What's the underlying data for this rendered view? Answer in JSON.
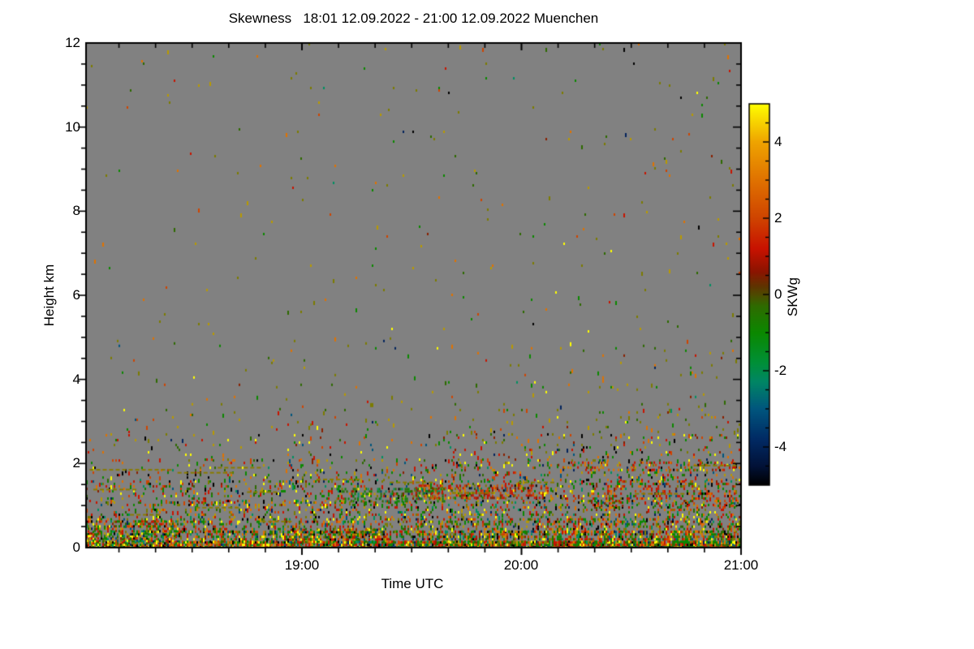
{
  "chart_data": {
    "type": "heatmap",
    "title": "Skewness   18:01 12.09.2022 - 21:00 12.09.2022 Muenchen",
    "xlabel": "Time UTC",
    "ylabel": "Height km",
    "x_start": "18:01",
    "x_end": "21:00",
    "x_total_minutes": 179,
    "x_ticks": [
      {
        "label": "19:00",
        "minutes": 59
      },
      {
        "label": "20:00",
        "minutes": 119
      },
      {
        "label": "21:00",
        "minutes": 179
      }
    ],
    "x_minor_step_minutes": 10,
    "x_first_minor_minute": 9,
    "ylim": [
      0,
      12
    ],
    "y_ticks": [
      {
        "label": "12",
        "km": 12
      },
      {
        "label": "10",
        "km": 10
      },
      {
        "label": "8",
        "km": 8
      },
      {
        "label": "6",
        "km": 6
      },
      {
        "label": "4",
        "km": 4
      },
      {
        "label": "2",
        "km": 2
      },
      {
        "label": "0",
        "km": 0
      }
    ],
    "y_minor_step_km": 0.5,
    "plot_bg": "#818181",
    "frame_color": "#000000",
    "colorbar": {
      "label": "SKWg",
      "range": [
        -5,
        5
      ],
      "ticks": [
        {
          "label": "4",
          "v": 4
        },
        {
          "label": "2",
          "v": 2
        },
        {
          "label": "0",
          "v": 0
        },
        {
          "label": "-2",
          "v": -2
        },
        {
          "label": "-4",
          "v": -4
        }
      ],
      "minor_step": 0.5,
      "stops": [
        [
          5.0,
          "#ffff00"
        ],
        [
          4.0,
          "#efa400"
        ],
        [
          3.0,
          "#e07200"
        ],
        [
          2.0,
          "#cf4400"
        ],
        [
          1.2,
          "#c81200"
        ],
        [
          0.6,
          "#8c1400"
        ],
        [
          0.2,
          "#5e3500"
        ],
        [
          0.0,
          "#4f4a00"
        ],
        [
          -0.3,
          "#2f6b00"
        ],
        [
          -1.0,
          "#0b8800"
        ],
        [
          -1.8,
          "#009038"
        ],
        [
          -2.3,
          "#008565"
        ],
        [
          -3.0,
          "#00567e"
        ],
        [
          -3.8,
          "#012a64"
        ],
        [
          -4.5,
          "#021238"
        ],
        [
          -5.0,
          "#000000"
        ]
      ]
    },
    "noise": {
      "seed": 42,
      "palette": [
        "#c81400",
        "#e07200",
        "#ffff00",
        "#b89a00",
        "#7c7c00",
        "#0b8800",
        "#2d6a00",
        "#009060",
        "#00557e",
        "#02235c",
        "#000000",
        "#8a2000",
        "#cf4400"
      ],
      "weight_sets": {
        "default": [
          14,
          9,
          8,
          6,
          8,
          16,
          10,
          5,
          3,
          3,
          7,
          4,
          9
        ],
        "highalt": [
          5,
          10,
          3,
          16,
          24,
          12,
          10,
          2,
          1,
          1,
          2,
          3,
          5
        ],
        "greens": [
          4,
          2,
          2,
          2,
          5,
          38,
          20,
          9,
          1,
          1,
          3,
          2,
          4
        ],
        "reds": [
          36,
          12,
          4,
          2,
          3,
          5,
          2,
          1,
          1,
          1,
          3,
          10,
          18
        ]
      },
      "layers": [
        {
          "h": [
            0.0,
            0.15
          ],
          "density": 0.88,
          "weights": "default"
        },
        {
          "h": [
            0.15,
            0.4
          ],
          "density": 0.55,
          "weights": "default"
        },
        {
          "h": [
            0.4,
            0.7
          ],
          "density": 0.33,
          "weights": "default"
        },
        {
          "h": [
            0.7,
            1.1
          ],
          "density": 0.22,
          "weights": "default"
        },
        {
          "h": [
            1.1,
            1.6
          ],
          "density": 0.19,
          "weights": "default"
        },
        {
          "h": [
            1.6,
            2.1
          ],
          "density": 0.11,
          "weights": "default"
        },
        {
          "h": [
            2.1,
            2.7
          ],
          "density": 0.055,
          "weights": "default"
        },
        {
          "h": [
            2.7,
            3.3
          ],
          "density": 0.027,
          "weights": "highalt"
        },
        {
          "h": [
            3.3,
            5.0
          ],
          "density": 0.011,
          "weights": "highalt"
        },
        {
          "h": [
            5.0,
            12.0
          ],
          "density": 0.0045,
          "weights": "highalt"
        }
      ],
      "clusters": [
        {
          "t": [
            0,
            25
          ],
          "h": [
            0.0,
            0.65
          ],
          "density": 0.35,
          "weights": "default"
        },
        {
          "t": [
            55,
            80
          ],
          "h": [
            0.15,
            0.45
          ],
          "density": 0.45,
          "weights": "default"
        },
        {
          "t": [
            68,
            98
          ],
          "h": [
            1.1,
            1.42
          ],
          "density": 0.4,
          "weights": "greens"
        },
        {
          "t": [
            90,
            126
          ],
          "h": [
            1.18,
            1.5
          ],
          "density": 0.38,
          "weights": "reds"
        },
        {
          "t": [
            138,
            179
          ],
          "h": [
            1.0,
            1.6
          ],
          "density": 0.2,
          "weights": "reds"
        },
        {
          "t": [
            128,
            179
          ],
          "h": [
            1.82,
            2.05
          ],
          "density": 0.16,
          "weights": "reds"
        }
      ],
      "streak_color": "#8a7c00",
      "streaks": [
        [
          1,
          23,
          1.85
        ],
        [
          2,
          13,
          1.38
        ],
        [
          25,
          40,
          1.78
        ],
        [
          36,
          48,
          1.9
        ],
        [
          30,
          42,
          0.95
        ],
        [
          44,
          52,
          1.32
        ],
        [
          63,
          75,
          1.62
        ],
        [
          83,
          95,
          1.55
        ],
        [
          100,
          112,
          1.3
        ],
        [
          118,
          128,
          1.55
        ],
        [
          150,
          163,
          1.28
        ],
        [
          166,
          178,
          1.95
        ],
        [
          12,
          20,
          0.78
        ],
        [
          48,
          56,
          0.62
        ]
      ]
    }
  }
}
